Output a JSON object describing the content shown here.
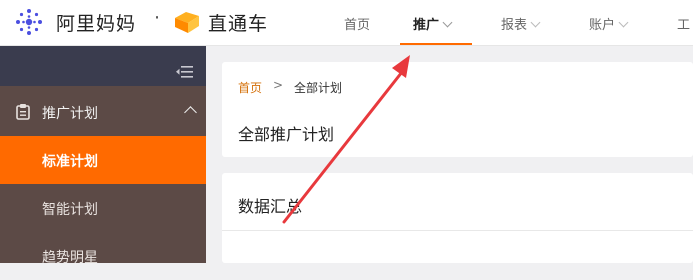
{
  "header": {
    "brand_name": "阿里妈妈",
    "brand_separator": "·",
    "product_name": "直通车",
    "nav": [
      {
        "label": "首页"
      },
      {
        "label": "推广"
      },
      {
        "label": "报表"
      },
      {
        "label": "账户"
      },
      {
        "label": "工"
      }
    ],
    "active_nav": "推广"
  },
  "sidebar": {
    "group_label": "推广计划",
    "items": [
      {
        "label": "标准计划",
        "active": true
      },
      {
        "label": "智能计划",
        "active": false
      },
      {
        "label": "趋势明星",
        "active": false
      }
    ]
  },
  "breadcrumb": {
    "home": "首页",
    "separator": ">",
    "current": "全部计划"
  },
  "page_title": "全部推广计划",
  "section_title": "数据汇总",
  "colors": {
    "accent": "#ff6a00",
    "sidebar_bg": "#5c4a46",
    "sidebar_top": "#3a3c4e",
    "annotation_arrow": "#e8393d"
  },
  "icons": [
    "alimama-logo-icon",
    "ztc-logo-icon",
    "collapse-menu-icon",
    "clipboard-icon",
    "chevron-up-icon",
    "chevron-down-icon"
  ]
}
